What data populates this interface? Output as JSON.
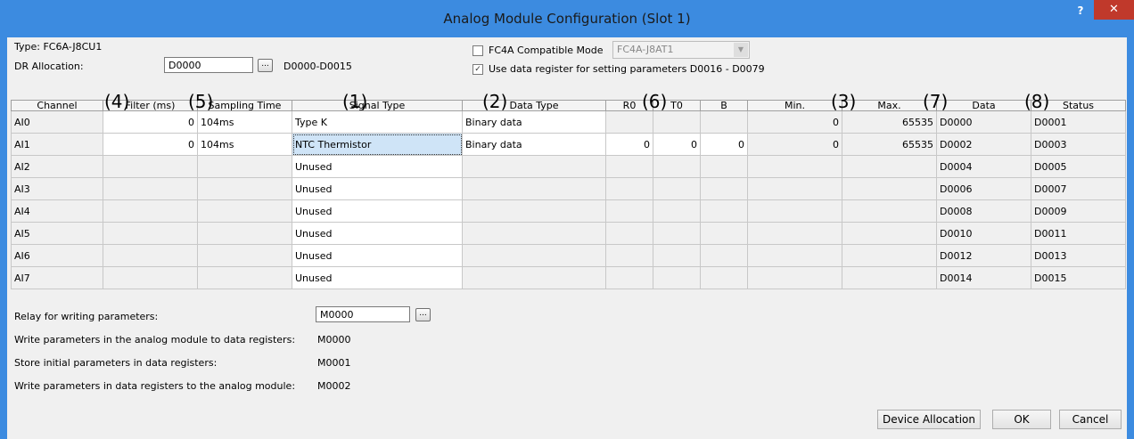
{
  "window": {
    "title": "Analog Module Configuration (Slot 1)",
    "help": "?",
    "close": "✕"
  },
  "type_label": "Type: FC6A-J8CU1",
  "dr_allocation": {
    "label": "DR Allocation:",
    "value": "D0000",
    "range": "D0000-D0015",
    "browse": "..."
  },
  "fc4a": {
    "label": "FC4A Compatible Mode",
    "checked": false,
    "value": "FC4A-J8AT1"
  },
  "use_dr": {
    "label": "Use data register for setting parameters D0016 - D0079",
    "checked": true
  },
  "columns": [
    "Channel",
    "Filter (ms)",
    "Sampling Time",
    "Signal Type",
    "Data Type",
    "R0",
    "T0",
    "B",
    "Min.",
    "Max.",
    "Data",
    "Status"
  ],
  "callouts": [
    "(4)",
    "(5)",
    "(1)",
    "(2)",
    "(6)",
    "(3)",
    "(7)",
    "(8)"
  ],
  "rows": [
    [
      "AI0",
      "0",
      "104ms",
      "Type K",
      "Binary data",
      "",
      "",
      "",
      "0",
      "65535",
      "D0000",
      "D0001"
    ],
    [
      "AI1",
      "0",
      "104ms",
      "NTC Thermistor",
      "Binary data",
      "0",
      "0",
      "0",
      "0",
      "65535",
      "D0002",
      "D0003"
    ],
    [
      "AI2",
      "",
      "",
      "Unused",
      "",
      "",
      "",
      "",
      "",
      "",
      "D0004",
      "D0005"
    ],
    [
      "AI3",
      "",
      "",
      "Unused",
      "",
      "",
      "",
      "",
      "",
      "",
      "D0006",
      "D0007"
    ],
    [
      "AI4",
      "",
      "",
      "Unused",
      "",
      "",
      "",
      "",
      "",
      "",
      "D0008",
      "D0009"
    ],
    [
      "AI5",
      "",
      "",
      "Unused",
      "",
      "",
      "",
      "",
      "",
      "",
      "D0010",
      "D0011"
    ],
    [
      "AI6",
      "",
      "",
      "Unused",
      "",
      "",
      "",
      "",
      "",
      "",
      "D0012",
      "D0013"
    ],
    [
      "AI7",
      "",
      "",
      "Unused",
      "",
      "",
      "",
      "",
      "",
      "",
      "D0014",
      "D0015"
    ]
  ],
  "relay": {
    "label": "Relay for writing parameters:",
    "value": "M0000",
    "browse": "..."
  },
  "params": [
    {
      "label": "Write parameters in the analog module to data registers:",
      "value": "M0000"
    },
    {
      "label": "Store initial parameters in data registers:",
      "value": "M0001"
    },
    {
      "label": "Write parameters in data registers to the analog module:",
      "value": "M0002"
    }
  ],
  "buttons": {
    "device_allocation": "Device Allocation",
    "ok": "OK",
    "cancel": "Cancel"
  }
}
